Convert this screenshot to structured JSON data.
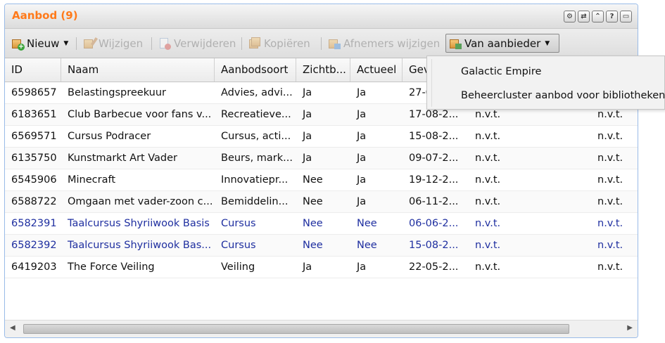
{
  "panel": {
    "title": "Aanbod (9)",
    "tools": [
      "gear-icon",
      "refresh-icon",
      "collapse-icon",
      "help-icon",
      "maximize-icon"
    ]
  },
  "toolbar": {
    "new_label": "Nieuw",
    "edit_label": "Wijzigen",
    "delete_label": "Verwijderen",
    "copy_label": "Kopiëren",
    "recipients_label": "Afnemers wijzigen",
    "provider_label": "Van aanbieder"
  },
  "grid": {
    "columns": [
      "ID",
      "Naam",
      "Aanbodsoort",
      "Zichtb...",
      "Actueel",
      "Gev"
    ],
    "rows": [
      {
        "id": "6598657",
        "naam": "Belastingspreekuur",
        "soort": "Advies, advi...",
        "zicht": "Ja",
        "actueel": "Ja",
        "datum": "27-0",
        "c7": "",
        "c8": ""
      },
      {
        "id": "6183651",
        "naam": "Club Barbecue voor fans v...",
        "soort": "Recreatieve...",
        "zicht": "Ja",
        "actueel": "Ja",
        "datum": "17-08-2...",
        "c7": "n.v.t.",
        "c8": "n.v.t."
      },
      {
        "id": "6569571",
        "naam": "Cursus Podracer",
        "soort": "Cursus, acti...",
        "zicht": "Ja",
        "actueel": "Ja",
        "datum": "15-08-2...",
        "c7": "n.v.t.",
        "c8": "n.v.t."
      },
      {
        "id": "6135750",
        "naam": "Kunstmarkt Art Vader",
        "soort": "Beurs, mark...",
        "zicht": "Ja",
        "actueel": "Ja",
        "datum": "09-07-2...",
        "c7": "n.v.t.",
        "c8": "n.v.t."
      },
      {
        "id": "6545906",
        "naam": "Minecraft",
        "soort": "Innovatiepr...",
        "zicht": "Nee",
        "actueel": "Ja",
        "datum": "19-12-2...",
        "c7": "n.v.t.",
        "c8": "n.v.t."
      },
      {
        "id": "6588722",
        "naam": "Omgaan met vader-zoon c...",
        "soort": "Bemiddelin...",
        "zicht": "Nee",
        "actueel": "Ja",
        "datum": "06-11-2...",
        "c7": "n.v.t.",
        "c8": "n.v.t."
      },
      {
        "id": "6582391",
        "naam": "Taalcursus Shyriiwook Basis",
        "soort": "Cursus",
        "zicht": "Nee",
        "actueel": "Nee",
        "datum": "06-06-2...",
        "c7": "n.v.t.",
        "c8": "n.v.t."
      },
      {
        "id": "6582392",
        "naam": "Taalcursus Shyriiwook Bas...",
        "soort": "Cursus",
        "zicht": "Nee",
        "actueel": "Nee",
        "datum": "15-08-2...",
        "c7": "n.v.t.",
        "c8": "n.v.t."
      },
      {
        "id": "6419203",
        "naam": "The Force Veiling",
        "soort": "Veiling",
        "zicht": "Ja",
        "actueel": "Ja",
        "datum": "22-05-2...",
        "c7": "n.v.t.",
        "c8": "n.v.t."
      }
    ]
  },
  "dropdown": {
    "items": [
      "Galactic Empire",
      "Beheercluster aanbod voor bibliotheken"
    ]
  },
  "colors": {
    "title": "#ff7a1a",
    "link_row": "#1f2fa0",
    "border": "#99bbe8"
  }
}
